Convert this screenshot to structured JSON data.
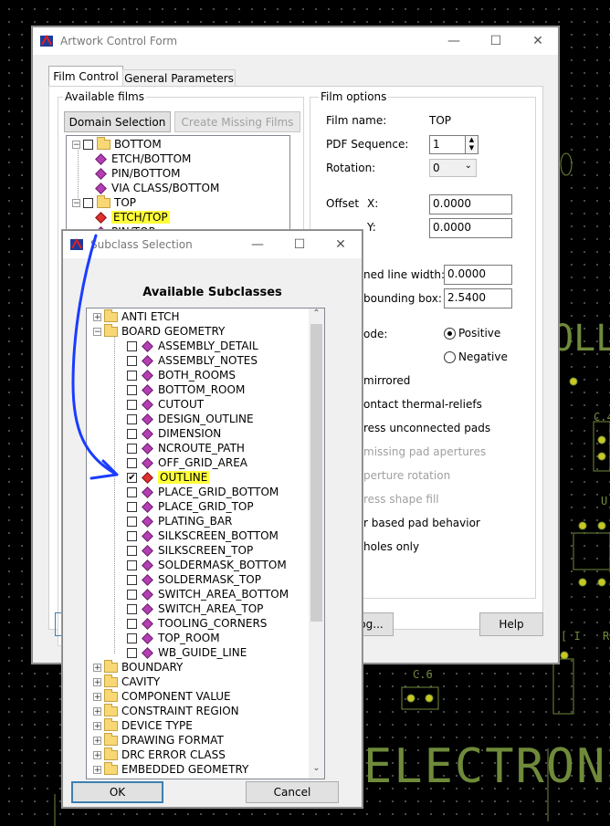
{
  "background": {
    "pcb_texts": [
      "OLLE",
      "C.4",
      "C.6",
      "ELECTRONI",
      "U",
      "R",
      "[ I"
    ]
  },
  "artwork_form": {
    "title": "Artwork Control Form",
    "tabs": [
      "Film Control",
      "General Parameters"
    ],
    "available_films": {
      "label": "Available films",
      "domain_selection": "Domain Selection",
      "create_missing_films": "Create Missing Films",
      "tree": [
        "BOTTOM",
        "ETCH/BOTTOM",
        "PIN/BOTTOM",
        "VIA CLASS/BOTTOM",
        "TOP",
        "ETCH/TOP",
        "PIN/TOP"
      ]
    },
    "film_options": {
      "label": "Film options",
      "film_name_label": "Film name:",
      "film_name_value": "TOP",
      "pdf_sequence_label": "PDF Sequence:",
      "pdf_sequence_value": "1",
      "rotation_label": "Rotation:",
      "rotation_value": "0",
      "offset_label": "Offset",
      "offset_x_label": "X:",
      "offset_x_value": "0.0000",
      "offset_y_label": "Y:",
      "offset_y_value": "0.0000",
      "line_width_label": "ned line width:",
      "line_width_value": "0.0000",
      "bounding_box_label": "bounding box:",
      "bounding_box_value": "2.5400",
      "mode_label": "ode:",
      "positive": "Positive",
      "negative": "Negative",
      "mirrored": "mirrored",
      "thermal": "ontact thermal-reliefs",
      "unconnected": "ress unconnected pads",
      "missing_apertures": "missing pad apertures",
      "aperture_rotation": "perture rotation",
      "shape_fill": "ress shape fill",
      "pad_behavior": "r based pad behavior",
      "holes_only": "holes only"
    },
    "buttons": {
      "dialog": "og...",
      "help": "Help"
    }
  },
  "subclass_dialog": {
    "title": "Subclass Selection",
    "heading": "Available Subclasses",
    "items": [
      {
        "label": "ANTI ETCH",
        "level": 0,
        "expanded": false
      },
      {
        "label": "BOARD GEOMETRY",
        "level": 0,
        "expanded": true
      },
      {
        "label": "ASSEMBLY_DETAIL",
        "level": 1,
        "checked": false
      },
      {
        "label": "ASSEMBLY_NOTES",
        "level": 1,
        "checked": false
      },
      {
        "label": "BOTH_ROOMS",
        "level": 1,
        "checked": false
      },
      {
        "label": "BOTTOM_ROOM",
        "level": 1,
        "checked": false
      },
      {
        "label": "CUTOUT",
        "level": 1,
        "checked": false
      },
      {
        "label": "DESIGN_OUTLINE",
        "level": 1,
        "checked": false
      },
      {
        "label": "DIMENSION",
        "level": 1,
        "checked": false
      },
      {
        "label": "NCROUTE_PATH",
        "level": 1,
        "checked": false
      },
      {
        "label": "OFF_GRID_AREA",
        "level": 1,
        "checked": false
      },
      {
        "label": "OUTLINE",
        "level": 1,
        "checked": true
      },
      {
        "label": "PLACE_GRID_BOTTOM",
        "level": 1,
        "checked": false
      },
      {
        "label": "PLACE_GRID_TOP",
        "level": 1,
        "checked": false
      },
      {
        "label": "PLATING_BAR",
        "level": 1,
        "checked": false
      },
      {
        "label": "SILKSCREEN_BOTTOM",
        "level": 1,
        "checked": false
      },
      {
        "label": "SILKSCREEN_TOP",
        "level": 1,
        "checked": false
      },
      {
        "label": "SOLDERMASK_BOTTOM",
        "level": 1,
        "checked": false
      },
      {
        "label": "SOLDERMASK_TOP",
        "level": 1,
        "checked": false
      },
      {
        "label": "SWITCH_AREA_BOTTOM",
        "level": 1,
        "checked": false
      },
      {
        "label": "SWITCH_AREA_TOP",
        "level": 1,
        "checked": false
      },
      {
        "label": "TOOLING_CORNERS",
        "level": 1,
        "checked": false
      },
      {
        "label": "TOP_ROOM",
        "level": 1,
        "checked": false
      },
      {
        "label": "WB_GUIDE_LINE",
        "level": 1,
        "checked": false
      },
      {
        "label": "BOUNDARY",
        "level": 0,
        "expanded": false
      },
      {
        "label": "CAVITY",
        "level": 0,
        "expanded": false
      },
      {
        "label": "COMPONENT VALUE",
        "level": 0,
        "expanded": false
      },
      {
        "label": "CONSTRAINT REGION",
        "level": 0,
        "expanded": false
      },
      {
        "label": "DEVICE TYPE",
        "level": 0,
        "expanded": false
      },
      {
        "label": "DRAWING FORMAT",
        "level": 0,
        "expanded": false
      },
      {
        "label": "DRC ERROR CLASS",
        "level": 0,
        "expanded": false
      },
      {
        "label": "EMBEDDED GEOMETRY",
        "level": 0,
        "expanded": false
      }
    ],
    "ok": "OK",
    "cancel": "Cancel"
  },
  "colors": {
    "highlight": "#ffff3a",
    "annotation_arrow": "#1a3cff",
    "pcb_text": "#6f8a3a"
  }
}
